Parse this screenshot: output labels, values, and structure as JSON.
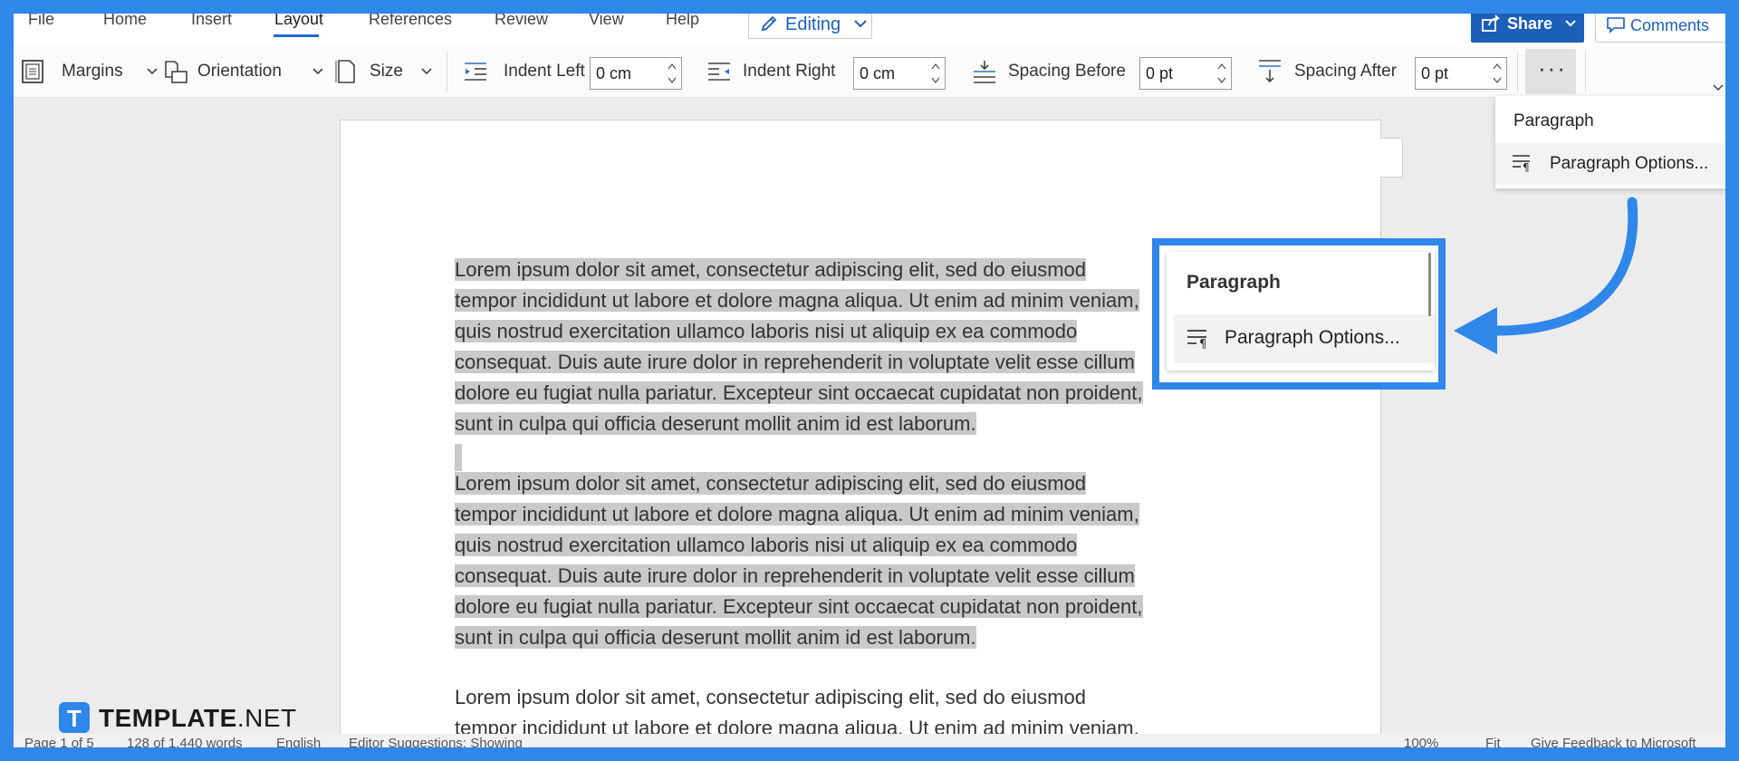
{
  "menu": {
    "items": [
      "File",
      "Home",
      "Insert",
      "Layout",
      "References",
      "Review",
      "View",
      "Help"
    ],
    "active": "Layout",
    "editing_label": "Editing",
    "share_label": "Share",
    "comments_label": "Comments"
  },
  "ribbon": {
    "margins_label": "Margins",
    "orientation_label": "Orientation",
    "size_label": "Size",
    "indent_left_label": "Indent Left",
    "indent_left_value": "0 cm",
    "indent_right_label": "Indent Right",
    "indent_right_value": "0 cm",
    "spacing_before_label": "Spacing Before",
    "spacing_before_value": "0 pt",
    "spacing_after_label": "Spacing After",
    "spacing_after_value": "0 pt",
    "more_label": "···"
  },
  "paragraph_menu": {
    "header": "Paragraph",
    "option": "Paragraph Options..."
  },
  "callout": {
    "header": "Paragraph",
    "option": "Paragraph Options..."
  },
  "document": {
    "paragraph1": [
      "Lorem ipsum dolor sit amet, consectetur adipiscing elit, sed do eiusmod",
      "tempor incididunt ut labore et dolore magna aliqua. Ut enim ad minim veniam,",
      "quis nostrud exercitation ullamco laboris nisi ut aliquip ex ea commodo",
      "consequat. Duis aute irure dolor in reprehenderit in voluptate velit esse cillum",
      "dolore eu fugiat nulla pariatur. Excepteur sint occaecat cupidatat non proident,",
      "sunt in culpa qui officia deserunt mollit anim id est laborum."
    ],
    "paragraph2": [
      "Lorem ipsum dolor sit amet, consectetur adipiscing elit, sed do eiusmod",
      "tempor incididunt ut labore et dolore magna aliqua. Ut enim ad minim veniam,",
      "quis nostrud exercitation ullamco laboris nisi ut aliquip ex ea commodo",
      "consequat. Duis aute irure dolor in reprehenderit in voluptate velit esse cillum",
      "dolore eu fugiat nulla pariatur. Excepteur sint occaecat cupidatat non proident,",
      "sunt in culpa qui officia deserunt mollit anim id est laborum."
    ],
    "paragraph3": [
      "Lorem ipsum dolor sit amet, consectetur adipiscing elit, sed do eiusmod",
      "tempor incididunt ut labore et dolore magna aliqua. Ut enim ad minim veniam,"
    ]
  },
  "status": {
    "page": "Page 1 of 5",
    "words": "128 of 1,440 words",
    "language": "English",
    "editor": "Editor Suggestions: Showing",
    "zoom": "100%",
    "fit": "Fit",
    "feedback": "Give Feedback to Microsoft"
  },
  "logo": {
    "mark": "T",
    "name": "TEMPLATE",
    "suffix": ".NET"
  },
  "colors": {
    "frame": "#2f87ea",
    "accent": "#1c5fb8",
    "selection": "#c9c9c9"
  }
}
